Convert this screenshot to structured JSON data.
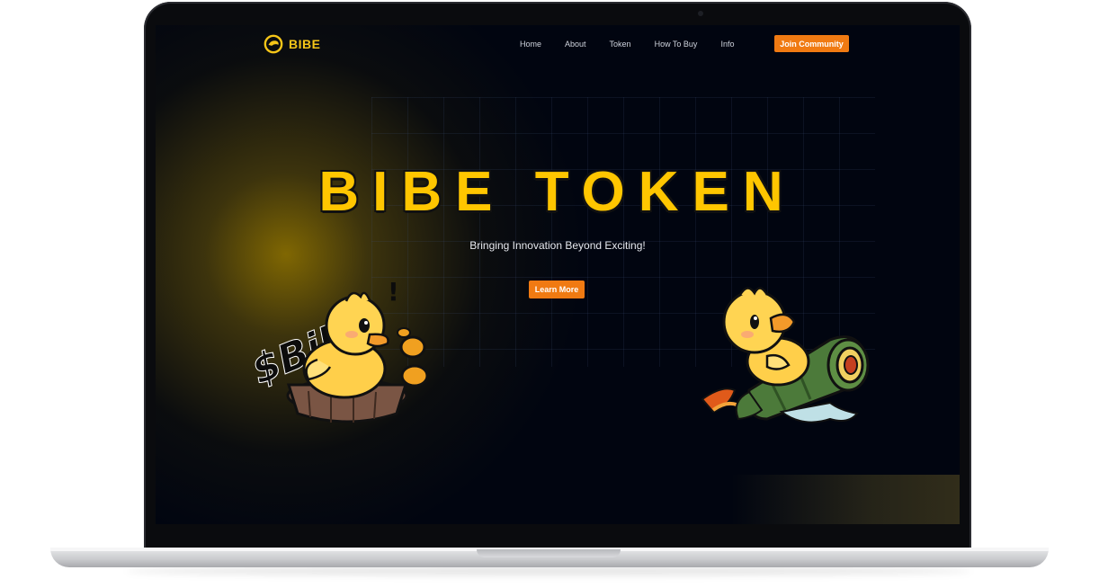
{
  "brand": {
    "name": "BIBE"
  },
  "nav": {
    "items": [
      {
        "label": "Home"
      },
      {
        "label": "About"
      },
      {
        "label": "Token"
      },
      {
        "label": "How To Buy"
      },
      {
        "label": "Info"
      }
    ],
    "cta_label": "Join Community"
  },
  "hero": {
    "title": "BIBE TOKEN",
    "subtitle": "Bringing Innovation Beyond Exciting!",
    "button_label": "Learn More"
  },
  "illustrations": {
    "left_graffiti": "$Bibe",
    "left_exclaim": "!"
  },
  "colors": {
    "accent_yellow": "#ffc600",
    "cta_orange": "#f07a12",
    "background": "#010510"
  },
  "icons": {
    "logo": "bibe-logo-icon",
    "duck_in_tub": "duck-in-tub-illustration",
    "duck_on_rocket": "duck-on-rocket-illustration"
  }
}
